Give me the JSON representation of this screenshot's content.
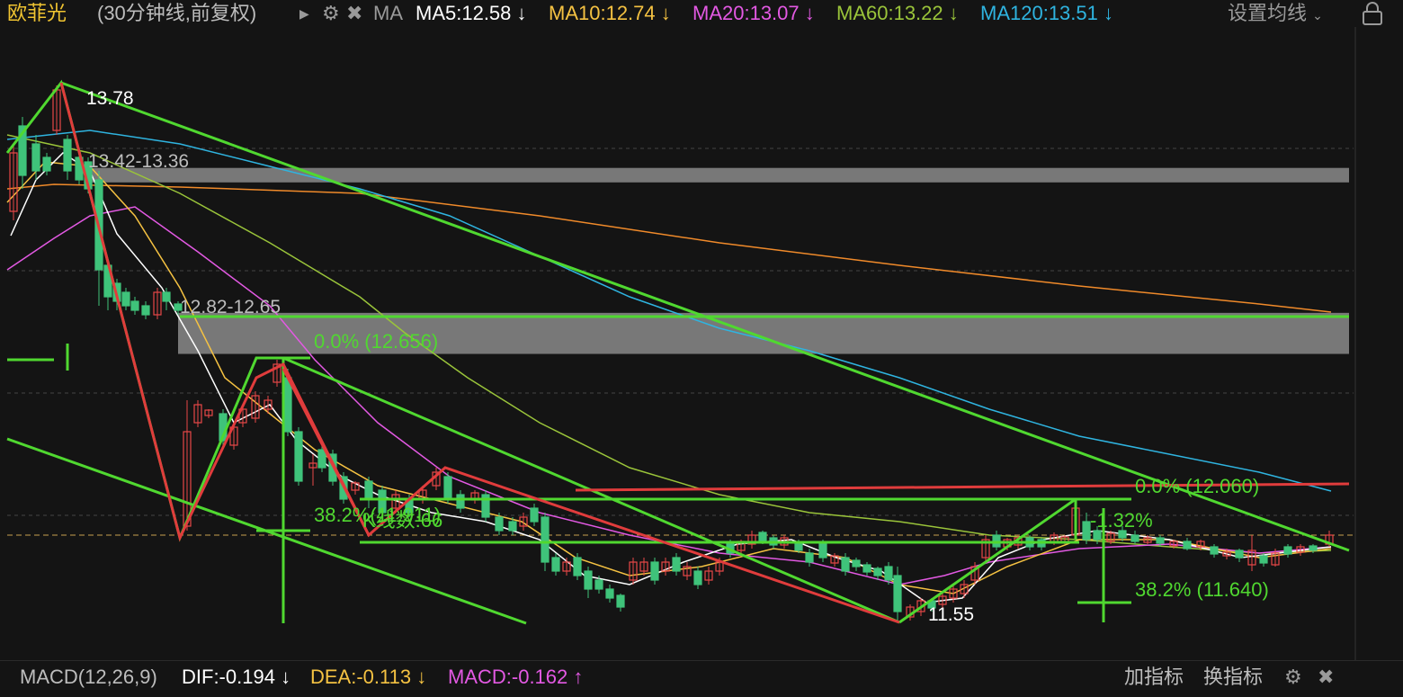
{
  "header": {
    "stock_name": "欧菲光",
    "period": "(30分钟线,前复权)",
    "ma_label": "MA",
    "ma": [
      {
        "label": "MA5:12.58",
        "arrow": "↓",
        "color": "#ffffff"
      },
      {
        "label": "MA10:12.74",
        "arrow": "↓",
        "color": "#f5c242"
      },
      {
        "label": "MA20:13.07",
        "arrow": "↓",
        "color": "#e359e3"
      },
      {
        "label": "MA60:13.22",
        "arrow": "↓",
        "color": "#9ac43a"
      },
      {
        "label": "MA120:13.51",
        "arrow": "↓",
        "color": "#2fb4e0"
      }
    ],
    "settings_label": "设置均线",
    "icons": {
      "expand": "triangle-right-icon",
      "gear": "gear-icon",
      "close": "close-icon",
      "dropdown": "chevron-down-icon",
      "lock": "lock-icon"
    }
  },
  "footer": {
    "macd_name": "MACD(12,26,9)",
    "dif": "DIF:-0.194",
    "dif_arrow": "↓",
    "dea": "DEA:-0.113",
    "dea_arrow": "↓",
    "macd": "MACD:-0.162",
    "macd_arrow": "↑",
    "add_indicator": "加指标",
    "switch_indicator": "换指标"
  },
  "chart_data": {
    "type": "candlestick",
    "ylim": [
      11.4,
      13.95
    ],
    "high_label": "13.78",
    "low_label": "11.55",
    "zones": [
      {
        "label": "13.42-13.36",
        "from": 13.36,
        "to": 13.42
      },
      {
        "label": "12.82-12.65",
        "from": 12.65,
        "to": 12.82
      }
    ],
    "fib_labels": [
      {
        "text": "0.0%   (12.656)",
        "price": 12.656
      },
      {
        "text": "38.2%  (11.911)",
        "price": 11.911
      },
      {
        "text": "0.0%   (12.060)",
        "price": 12.06
      },
      {
        "text": "38.2%  (11.640)",
        "price": 11.64
      },
      {
        "text": "-1.32%",
        "price": 11.98
      }
    ],
    "overlap_text": "K线数:66",
    "current_price": 11.9,
    "colors": {
      "up": "#e84848",
      "down": "#3fc37a",
      "ma5": "#ffffff",
      "ma10": "#f5c242",
      "ma20": "#e359e3",
      "ma60": "#9ac43a",
      "ma120": "#2fb4e0",
      "ma250": "#f08a2a",
      "trend": "#50d830",
      "red_trend": "#e03c3c"
    }
  }
}
